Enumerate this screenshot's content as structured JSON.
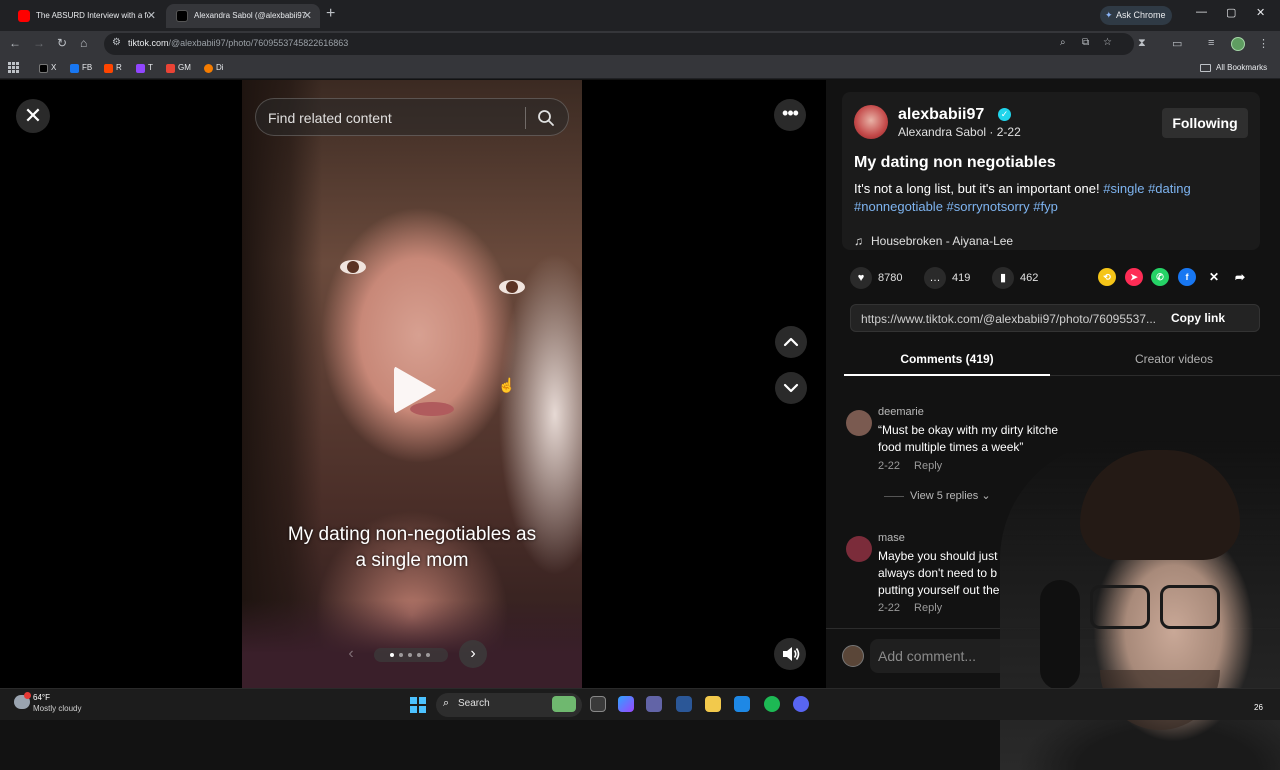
{
  "browser": {
    "tabs": [
      {
        "title": "The ABSURD Interview with a fe",
        "icon": "youtube-icon",
        "active": false
      },
      {
        "title": "Alexandra Sabol (@alexbabii97)",
        "icon": "tiktok-icon",
        "active": true
      }
    ],
    "ask_chrome": "Ask Chrome",
    "url_host": "tiktok.com",
    "url_path": "/@alexbabii97/photo/7609553745822616863",
    "bookmarks": [
      {
        "label": "X",
        "color": "#000000"
      },
      {
        "label": "FB",
        "color": "#1877f2"
      },
      {
        "label": "R",
        "color": "#ff4500"
      },
      {
        "label": "T",
        "color": "#9146ff"
      },
      {
        "label": "GM",
        "color": "#ea4335"
      },
      {
        "label": "Di",
        "color": "#f57c00"
      }
    ],
    "all_bookmarks": "All Bookmarks"
  },
  "viewer": {
    "search_placeholder": "Find related content",
    "caption_line1": "My dating non-negotiables as",
    "caption_line2": "a single mom",
    "carousel": {
      "total": 5,
      "current": 1
    }
  },
  "post": {
    "username": "alexbabii97",
    "nickname": "Alexandra Sabol",
    "date": "2-22",
    "follow_label": "Following",
    "title": "My dating non negotiables",
    "description": "It's not a long list, but it's an important one!",
    "hashtags": [
      "#single",
      "#dating",
      "#nonnegotiable",
      "#sorrynotsorry",
      "#fyp"
    ],
    "music": "Housebroken - Aiyana-Lee",
    "likes": "8780",
    "comments": "419",
    "saves": "462",
    "link": "https://www.tiktok.com/@alexbabii97/photo/76095537...",
    "copy_link": "Copy link",
    "share_colors": {
      "repost": "#f5c518",
      "tiktok": "#fe2c55",
      "whatsapp": "#25d366",
      "facebook": "#1877f2"
    }
  },
  "tabs": {
    "comments": "Comments (419)",
    "creator_videos": "Creator videos"
  },
  "comments": [
    {
      "user": "deemarie",
      "text": "“Must be okay with my dirty kitche food multiple times a week”",
      "date": "2-22",
      "reply": "Reply",
      "view_replies": "View 5 replies"
    },
    {
      "user": "mase",
      "text": "Maybe you should just always don't need to b putting yourself out the",
      "date": "2-22",
      "reply": "Reply"
    }
  ],
  "add_comment_placeholder": "Add comment...",
  "taskbar": {
    "temp": "64°F",
    "condition": "Mostly cloudy",
    "search": "Search",
    "tray_number": "26"
  }
}
